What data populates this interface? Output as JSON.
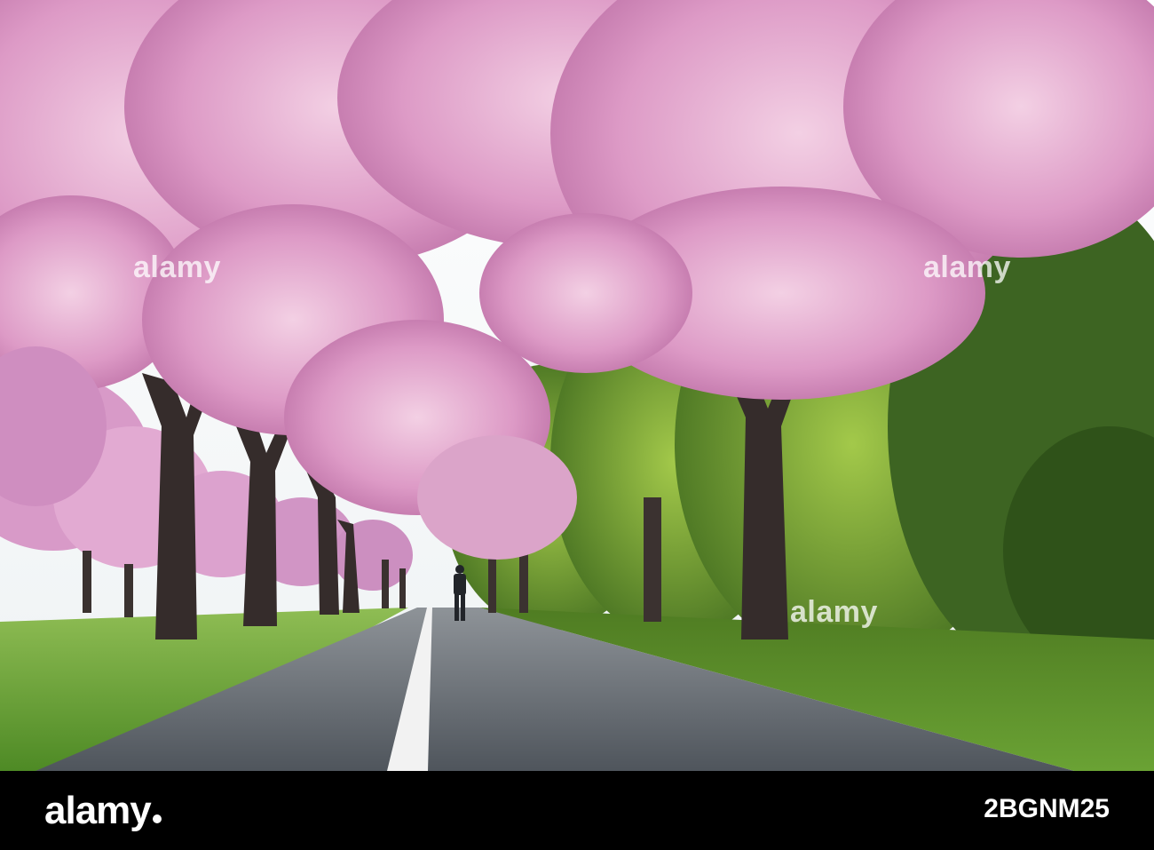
{
  "photo": {
    "subject": "cherry-blossom-avenue",
    "colors": {
      "sky": "#f4f6fa",
      "blossom_light": "#f0c6df",
      "blossom_mid": "#d58bbd",
      "blossom_dark": "#a8558f",
      "foliage": "#5c8b2c",
      "grass": "#6da83a",
      "road": "#5b6169",
      "stripe": "#f2f2f2",
      "trunk": "#3b3230"
    },
    "watermarks": {
      "left": "alamy",
      "right": "alamy",
      "center": "alamy"
    }
  },
  "footer": {
    "brand": "alamy",
    "image_id": "2BGNM25",
    "background": "#000000"
  }
}
